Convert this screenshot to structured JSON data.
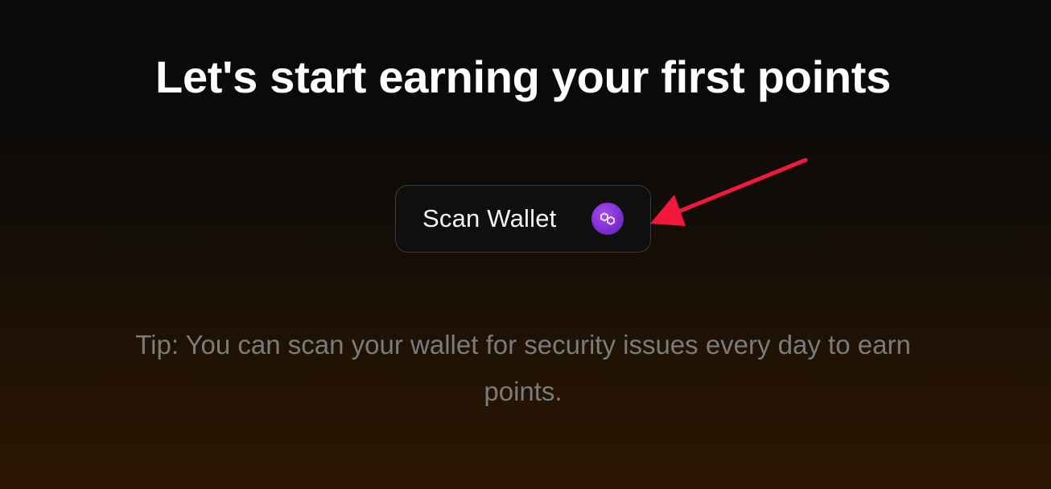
{
  "header": {
    "title": "Let's start earning your first points"
  },
  "scan_button": {
    "label": "Scan Wallet",
    "icon": "polygon-chain-icon"
  },
  "tip": {
    "line1": "Tip: You can scan your wallet for security issues every day to earn",
    "line2": "points."
  },
  "colors": {
    "arrow": "#f0193c",
    "icon_bg": "#8a3ee0",
    "tip_text": "#7b7b7b"
  }
}
